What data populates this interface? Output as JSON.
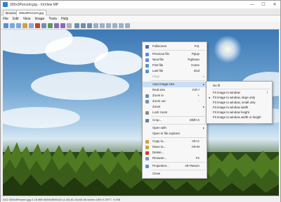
{
  "window": {
    "title": "305x3Percent.jpg - XnView MP",
    "minimize": "—",
    "maximize": "☐",
    "close": "✕"
  },
  "tabs": [
    {
      "label": "Browser"
    },
    {
      "label": "305x3Percent.jpg"
    }
  ],
  "menubar": [
    "File",
    "Edit",
    "View",
    "Image",
    "Tools",
    "Help"
  ],
  "statusbar": {
    "text": "3/12  305x3Percent.jpg  2.16 MiB  5854x3890x24 (1.50)  81.31x54.06 inches  18%  X:2977, Y:298"
  },
  "context_menu": {
    "items": [
      {
        "label": "Fullscreen",
        "shortcut": "F11",
        "icon_color": "#3a6fc0"
      },
      {
        "sep": true
      },
      {
        "label": "Previous file",
        "shortcut": "PgUp",
        "icon_color": "#5a8fd6"
      },
      {
        "label": "Next file",
        "shortcut": "PgDown",
        "icon_color": "#5a8fd6"
      },
      {
        "label": "First file",
        "shortcut": "Home",
        "icon_color": "#5a8fd6"
      },
      {
        "label": "Last file",
        "shortcut": "End",
        "icon_color": "#5a8fd6"
      },
      {
        "label": "Page",
        "shortcut": "",
        "disabled": true,
        "submenu": true
      },
      {
        "sep": true
      },
      {
        "label": "Auto image size",
        "shortcut": "",
        "highlighted": true,
        "submenu": true
      },
      {
        "label": "Real size",
        "shortcut": "Ctrl+/"
      },
      {
        "label": "Zoom in",
        "shortcut": "+",
        "icon_color": "#6a8fb8"
      },
      {
        "label": "Zoom out",
        "shortcut": "-",
        "icon_color": "#6a8fb8"
      },
      {
        "label": "Zoom",
        "shortcut": "",
        "submenu": true
      },
      {
        "label": "Lock zoom",
        "shortcut": "",
        "icon_color": "#8a8a8a"
      },
      {
        "sep": true
      },
      {
        "label": "Crop...",
        "shortcut": "Shift+X",
        "icon_color": "#5a7fb0"
      },
      {
        "sep": true
      },
      {
        "label": "Open with",
        "shortcut": "",
        "submenu": true
      },
      {
        "label": "Open in file explorer",
        "shortcut": ""
      },
      {
        "sep": true
      },
      {
        "label": "Copy to...",
        "shortcut": "Alt+C",
        "icon_color": "#d0a040"
      },
      {
        "label": "Move to...",
        "shortcut": "Alt+M",
        "icon_color": "#d0a040"
      },
      {
        "label": "Delete...",
        "shortcut": "",
        "icon_color": "#c84030"
      },
      {
        "label": "Rename...",
        "shortcut": "F2",
        "icon_color": "#7a9ac0"
      },
      {
        "sep": true
      },
      {
        "label": "Properties...",
        "shortcut": "Alt+Return",
        "icon_color": "#5a8fd6"
      },
      {
        "sep": true
      },
      {
        "label": "Close",
        "shortcut": ""
      }
    ]
  },
  "submenu": {
    "items": [
      {
        "label": "No fit",
        "checked": false
      },
      {
        "sep": true
      },
      {
        "label": "Fit image to window",
        "checked": false,
        "shortcut": "/"
      },
      {
        "label": "Fit image to window, large only",
        "checked": true
      },
      {
        "label": "Fit image to window, small only",
        "checked": false
      },
      {
        "label": "Fit image to window width",
        "checked": false
      },
      {
        "label": "Fit image to window height",
        "checked": false
      },
      {
        "label": "Fit image to window width or height",
        "checked": false
      }
    ]
  }
}
